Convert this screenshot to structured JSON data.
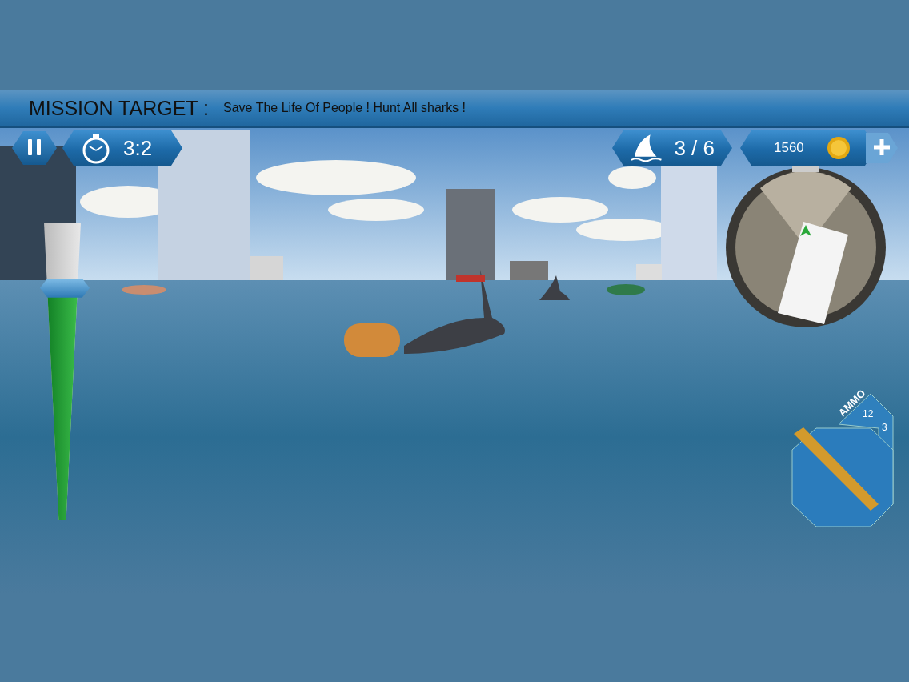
{
  "mission": {
    "label": "MISSION TARGET :",
    "text": "Save The Life Of People ! Hunt All sharks !"
  },
  "timer": {
    "value": "3:2"
  },
  "sharks": {
    "count": "3 / 6"
  },
  "coins": {
    "amount": "1560"
  },
  "depth_gauge": {
    "level": 0.78
  },
  "ammo": {
    "label": "AMMO",
    "loaded": "12",
    "reserve": "3"
  }
}
